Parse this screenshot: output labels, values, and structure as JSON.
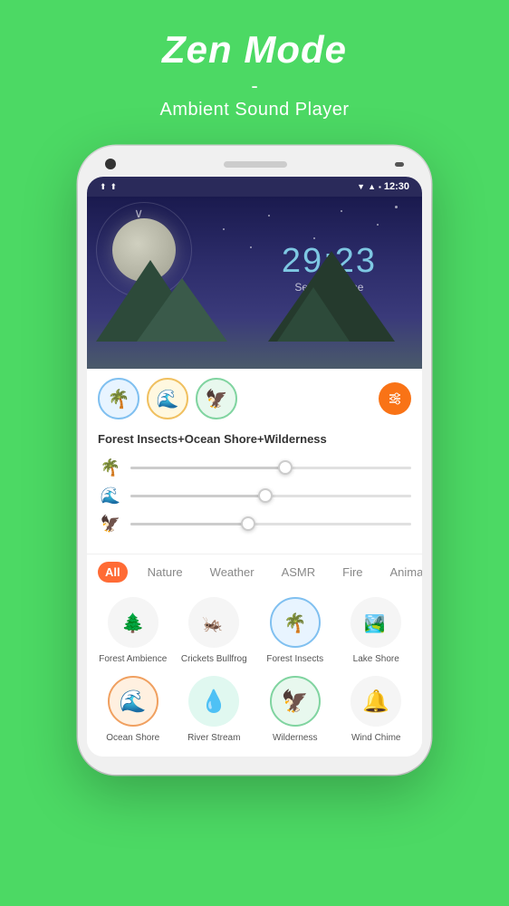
{
  "header": {
    "title": "Zen Mode",
    "subtitle_dash": "-",
    "subtitle": "Ambient Sound Player"
  },
  "status_bar": {
    "time": "12:30"
  },
  "hero": {
    "timer": "29:23",
    "timer_label": "Set sleep time"
  },
  "sound_mix": {
    "label": "Forest Insects+Ocean Shore+Wilderness"
  },
  "sliders": [
    {
      "id": "forest-insects",
      "value": 55
    },
    {
      "id": "ocean-shore",
      "value": 48
    },
    {
      "id": "wilderness",
      "value": 42
    }
  ],
  "categories": [
    {
      "label": "All",
      "active": true
    },
    {
      "label": "Nature",
      "active": false
    },
    {
      "label": "Weather",
      "active": false
    },
    {
      "label": "ASMR",
      "active": false
    },
    {
      "label": "Fire",
      "active": false
    },
    {
      "label": "Animal",
      "active": false
    }
  ],
  "sound_items_row1": [
    {
      "label": "Forest Ambience",
      "icon": "🌲",
      "selected": false
    },
    {
      "label": "Crickets Bullfrog",
      "icon": "🦗",
      "selected": false
    },
    {
      "label": "Forest Insects",
      "icon": "🌴",
      "selected": true
    },
    {
      "label": "Lake Shore",
      "icon": "🏞️",
      "selected": false
    }
  ],
  "sound_items_row2": [
    {
      "label": "Ocean Shore",
      "icon": "🌊",
      "selected": false,
      "style": "orange"
    },
    {
      "label": "River Stream",
      "icon": "💧",
      "selected": false,
      "style": "teal"
    },
    {
      "label": "Wilderness",
      "icon": "🦅",
      "selected": true,
      "style": "green"
    },
    {
      "label": "Wind Chime",
      "icon": "🔔",
      "selected": false,
      "style": "plain"
    }
  ]
}
